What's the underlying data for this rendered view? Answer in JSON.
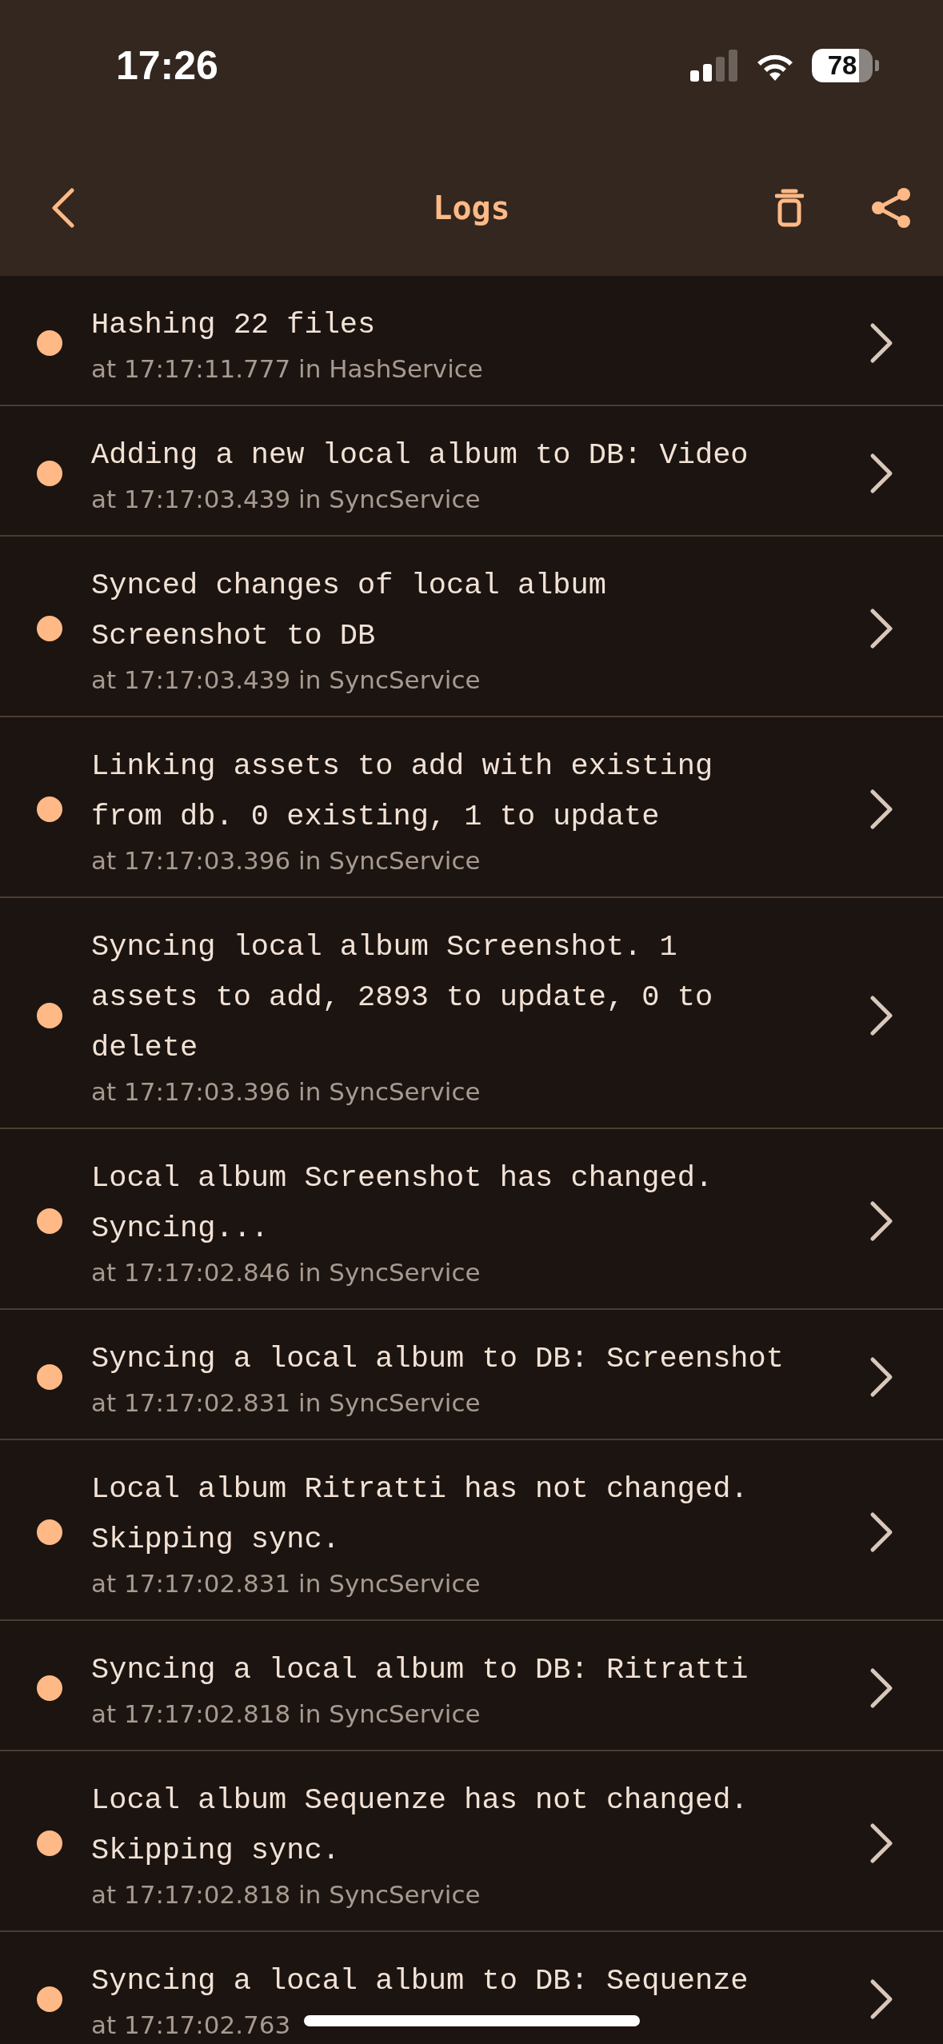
{
  "status_bar": {
    "time": "17:26",
    "battery": "78"
  },
  "nav": {
    "title": "Logs"
  },
  "logs": [
    {
      "message": "Hashing 22 files",
      "meta": "at 17:17:11.777 in HashService"
    },
    {
      "message": "Adding a new local album to DB: Video",
      "meta": "at 17:17:03.439 in SyncService"
    },
    {
      "message": "Synced changes of local album Screenshot to DB",
      "meta": "at 17:17:03.439 in SyncService"
    },
    {
      "message": "Linking assets to add with existing from db. 0 existing, 1 to update",
      "meta": "at 17:17:03.396 in SyncService"
    },
    {
      "message": "Syncing local album Screenshot. 1 assets to add, 2893 to update, 0 to delete",
      "meta": "at 17:17:03.396 in SyncService"
    },
    {
      "message": "Local album Screenshot has changed. Syncing...",
      "meta": "at 17:17:02.846 in SyncService"
    },
    {
      "message": "Syncing a local album to DB: Screenshot",
      "meta": "at 17:17:02.831 in SyncService"
    },
    {
      "message": "Local album Ritratti has not changed. Skipping sync.",
      "meta": "at 17:17:02.831 in SyncService"
    },
    {
      "message": "Syncing a local album to DB: Ritratti",
      "meta": "at 17:17:02.818 in SyncService"
    },
    {
      "message": "Local album Sequenze has not changed. Skipping sync.",
      "meta": "at 17:17:02.818 in SyncService"
    },
    {
      "message": "Syncing a local album to DB: Sequenze",
      "meta": "at 17:17:02.763"
    }
  ]
}
